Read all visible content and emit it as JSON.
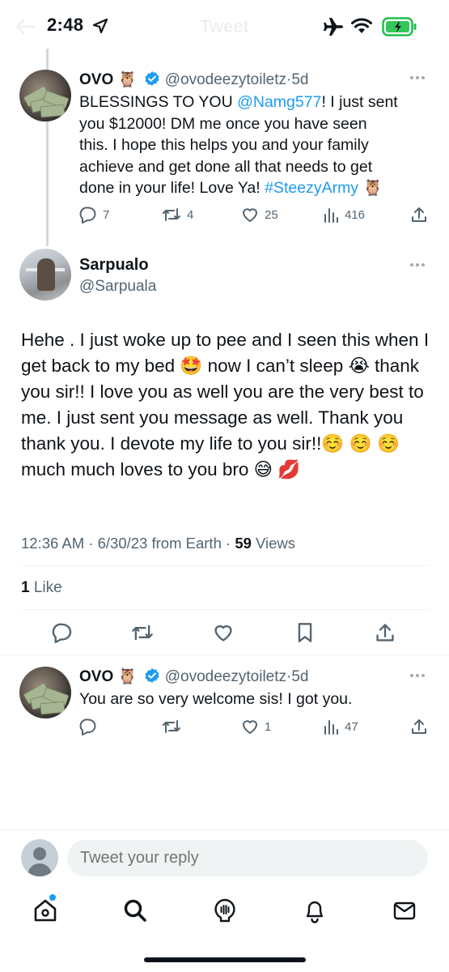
{
  "status_bar": {
    "time": "2:48"
  },
  "header": {
    "title": "Tweet"
  },
  "parent_tweet": {
    "name": "OVO",
    "emoji": "🦉",
    "handle": "@ovodeezytoiletz",
    "age": "5d",
    "text_parts": [
      "BLESSINGS TO YOU ",
      "@Namg577",
      "! I just sent\nyou $12000! DM me once you have seen\nthis. I hope this helps you and your family\nachieve and get done all that needs to get\ndone in your life! Love Ya! ",
      "#SteezyArmy",
      " 🦉"
    ],
    "replies": "7",
    "retweets": "4",
    "likes": "25",
    "views": "416"
  },
  "main_tweet": {
    "name": "Sarpualo",
    "handle": "@Sarpuala",
    "text": "Hehe . I just woke up to pee and I seen this when I get back to my bed 🤩 now I can’t sleep 😭 thank you sir!! I love you as well you are the very best to me. I just sent you message as well. Thank you thank you. I devote my life to you sir!!☺️ ☺️ ☺️ much much loves to you bro 😅 💋",
    "time": "12:36 AM",
    "date": "6/30/23",
    "source": "from Earth",
    "views_count": "59",
    "views_label": "Views",
    "likes_count": "1",
    "likes_label": "Like"
  },
  "reply_tweet": {
    "name": "OVO",
    "emoji": "🦉",
    "handle": "@ovodeezytoiletz",
    "age": "5d",
    "text": "You are so very welcome sis! I got you.",
    "replies": "",
    "retweets": "",
    "likes": "1",
    "views": "47"
  },
  "composer": {
    "placeholder": "Tweet your reply"
  },
  "colors": {
    "accent": "#1d9bf0",
    "muted": "#536471",
    "text": "#0f1419"
  },
  "icons": [
    "location-arrow-icon",
    "airplane-icon",
    "wifi-icon",
    "battery-icon",
    "verified-badge-icon",
    "more-icon",
    "reply-icon",
    "retweet-icon",
    "like-icon",
    "views-icon",
    "share-icon",
    "bookmark-icon",
    "home-icon",
    "search-icon",
    "spaces-icon",
    "notifications-icon",
    "messages-icon"
  ]
}
